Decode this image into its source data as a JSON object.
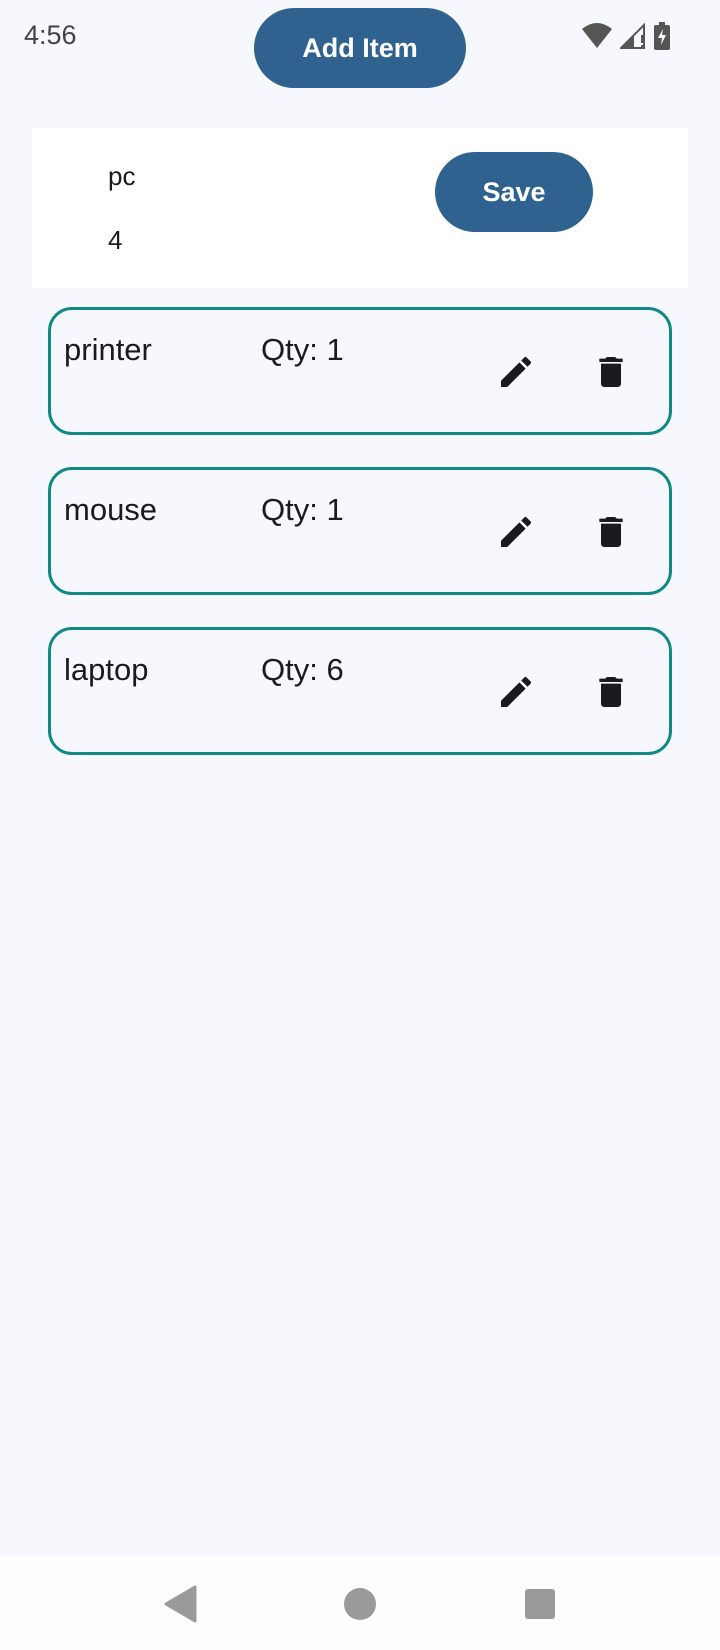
{
  "status_bar": {
    "time": "4:56",
    "icons": [
      "wifi-icon",
      "cell-signal-icon",
      "battery-charging-icon"
    ]
  },
  "toolbar": {
    "add_label": "Add Item"
  },
  "editor": {
    "name_value": "pc",
    "quantity_value": "4",
    "save_label": "Save"
  },
  "items": [
    {
      "name": "printer",
      "qty": "Qty: 1"
    },
    {
      "name": "mouse",
      "qty": "Qty: 1"
    },
    {
      "name": "laptop",
      "qty": "Qty: 6"
    }
  ],
  "item_icons": {
    "edit": "pencil-icon",
    "delete": "trash-icon"
  },
  "nav": {
    "icons": [
      "back-icon",
      "home-icon",
      "recents-icon"
    ]
  },
  "colors": {
    "primary": "#2f628e",
    "card_border": "#108a85",
    "background": "#f7f8fd",
    "text": "#1b1b1f"
  }
}
